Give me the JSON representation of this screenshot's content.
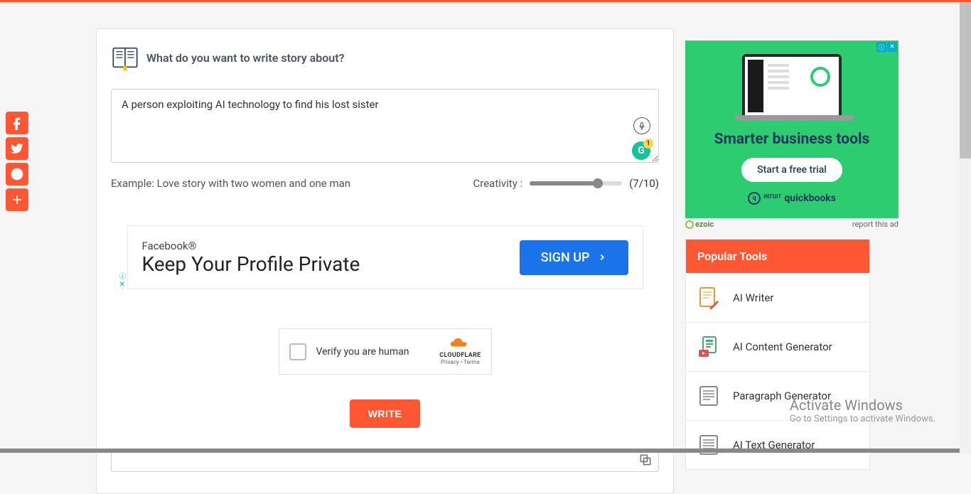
{
  "prompt": {
    "label": "What do you want to write story about?",
    "value": "A person exploiting AI technology to find his lost sister",
    "example": "Example: Love story with two women and one man"
  },
  "creativity": {
    "label": "Creativity :",
    "display": "(7/10)"
  },
  "inline_ad": {
    "brand": "Facebook®",
    "headline": "Keep Your Profile Private",
    "cta": "SIGN UP"
  },
  "captcha": {
    "text": "Verify you are human",
    "provider": "CLOUDFLARE",
    "links": "Privacy • Terms"
  },
  "write_btn": "WRITE",
  "sidebar_ad": {
    "title": "Smarter business tools",
    "cta": "Start a free trial",
    "brand_small": "INTUIT",
    "brand": "quickbooks"
  },
  "ad_footer": {
    "ezoic": "ezoic",
    "report": "report this ad"
  },
  "popular": {
    "header": "Popular Tools",
    "items": [
      "AI Writer",
      "AI Content Generator",
      "Paragraph Generator",
      "AI Text Generator"
    ]
  },
  "watermark": {
    "line1": "Activate Windows",
    "line2": "Go to Settings to activate Windows."
  }
}
